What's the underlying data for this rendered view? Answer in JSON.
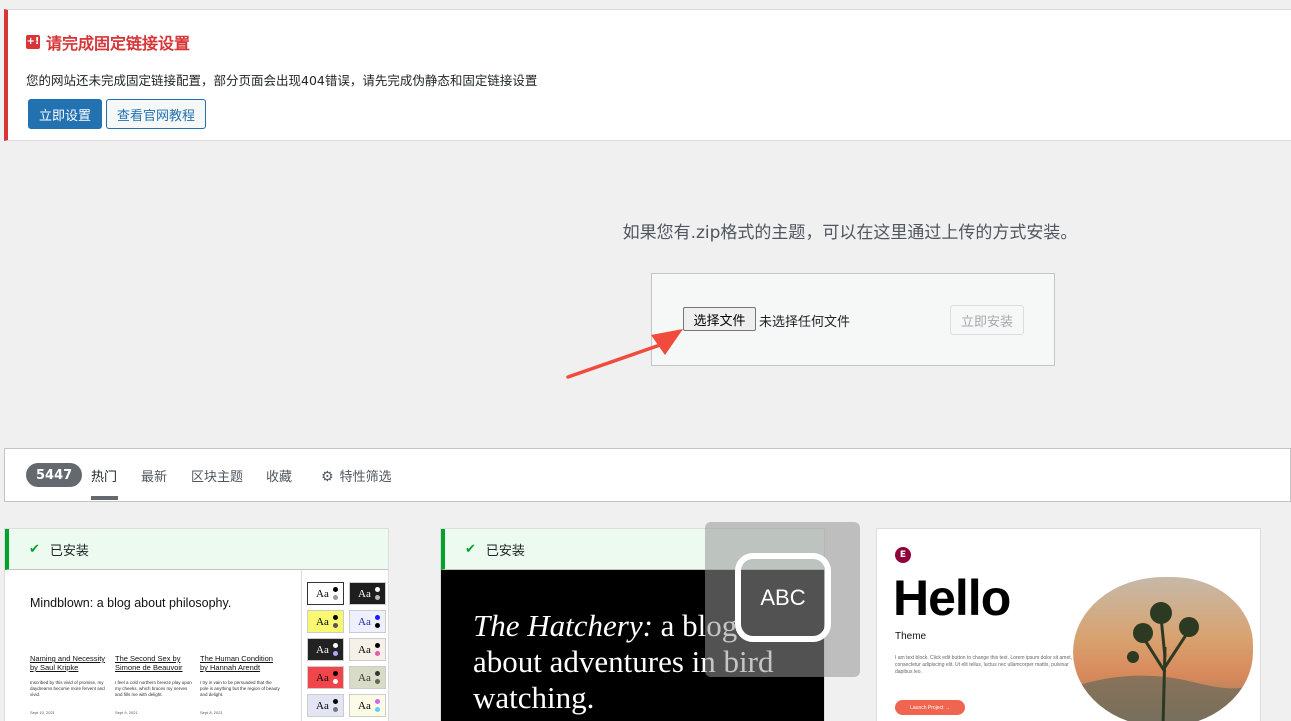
{
  "notice": {
    "title": "请完成固定链接设置",
    "description": "您的网站还未完成固定链接配置，部分页面会出现404错误，请先完成伪静态和固定链接设置",
    "primary_button": "立即设置",
    "secondary_button": "查看官网教程",
    "icon": "warning-icon",
    "accent_color": "#d63638"
  },
  "upload": {
    "help_text": "如果您有.zip格式的主题，可以在这里通过上传的方式安装。",
    "choose_file_label": "选择文件",
    "no_file_label": "未选择任何文件",
    "install_label": "立即安装"
  },
  "filters": {
    "count": "5447",
    "tabs": [
      "热门",
      "最新",
      "区块主题",
      "收藏"
    ],
    "feature_filter": "特性筛选"
  },
  "themes": [
    {
      "status": "已安装",
      "preview_title": "Mindblown: a blog about philosophy.",
      "posts": [
        {
          "title": "Naming and Necessity by Saul Kripke",
          "desc": "Inscribed by this vivid of promise, my daydreams become more fervent and vivid.",
          "date": "Sept 10, 2021"
        },
        {
          "title": "The Second Sex by Simone de Beauvoir",
          "desc": "I feel a cold northern breeze play upon my cheeks, which braces my nerves and fills me with delight.",
          "date": "Sept 9, 2021"
        },
        {
          "title": "The Human Condition by Hannah Arendt",
          "desc": "I try in vain to be persuaded that the pole is anything but the region of beauty and delight.",
          "date": "Sept 8, 2021"
        }
      ],
      "swatch_label": "Aa"
    },
    {
      "status": "已安装",
      "preview_italic": "The Hatchery:",
      "preview_rest": " a blog about adventures in bird watching."
    },
    {
      "preview_title": "Hello",
      "preview_subtitle": "Theme",
      "preview_body": "I am text block. Click edit button to change this text. Lorem ipsum dolor sit amet, consectetur adipiscing elit. Ut elit tellus, luctus nec ullamcorper mattis, pulvinar dapibus leo.",
      "preview_button": "Launch Project  →"
    }
  ],
  "overlay": {
    "label": "ABC"
  }
}
